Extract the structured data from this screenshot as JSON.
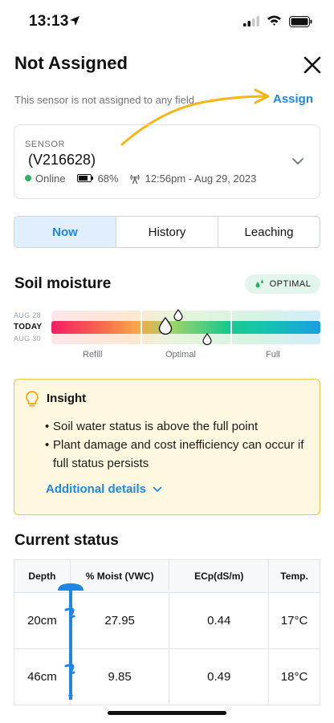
{
  "status_bar": {
    "time": "13:13",
    "icons": [
      "location-arrow-icon",
      "cellular-signal-icon",
      "wifi-icon",
      "battery-icon"
    ]
  },
  "header": {
    "title": "Not Assigned",
    "close_icon": "close-icon"
  },
  "assign": {
    "note": "This sensor is not assigned to any field.",
    "link_label": "Assign"
  },
  "sensor": {
    "kicker": "SENSOR",
    "id": "(V216628)",
    "status": "Online",
    "battery": "68%",
    "last_reading": "12:56pm - Aug 29, 2023",
    "status_color": "#28b463"
  },
  "tabs": [
    {
      "label": "Now",
      "active": true
    },
    {
      "label": "History",
      "active": false
    },
    {
      "label": "Leaching",
      "active": false
    }
  ],
  "soil_moisture": {
    "title": "Soil moisture",
    "badge": "OPTIMAL",
    "rows": [
      "AUG 28",
      "TODAY",
      "AUG 30"
    ],
    "zones": [
      "Refill",
      "Optimal",
      "Full"
    ],
    "today_marker_position": 0.42,
    "aug28_marker_position": 0.61,
    "aug30_marker_position": 0.71
  },
  "insight": {
    "title": "Insight",
    "bullets": [
      "Soil water status is above the full point",
      "Plant damage and cost inefficiency can occur if full status persists"
    ],
    "details_label": "Additional details"
  },
  "current_status": {
    "title": "Current status",
    "columns": [
      "Depth",
      "% Moist (VWC)",
      "ECp(dS/m)",
      "Temp."
    ],
    "rows": [
      {
        "depth": "20cm",
        "moist": "27.95",
        "ec": "0.44",
        "temp": "17°C"
      },
      {
        "depth": "46cm",
        "moist": "9.85",
        "ec": "0.49",
        "temp": "18°C"
      }
    ]
  },
  "colors": {
    "accent": "#1d86e6",
    "annotation_arrow": "#f5b617",
    "insight_bg": "#fff8e1",
    "insight_border": "#f3c24a"
  }
}
